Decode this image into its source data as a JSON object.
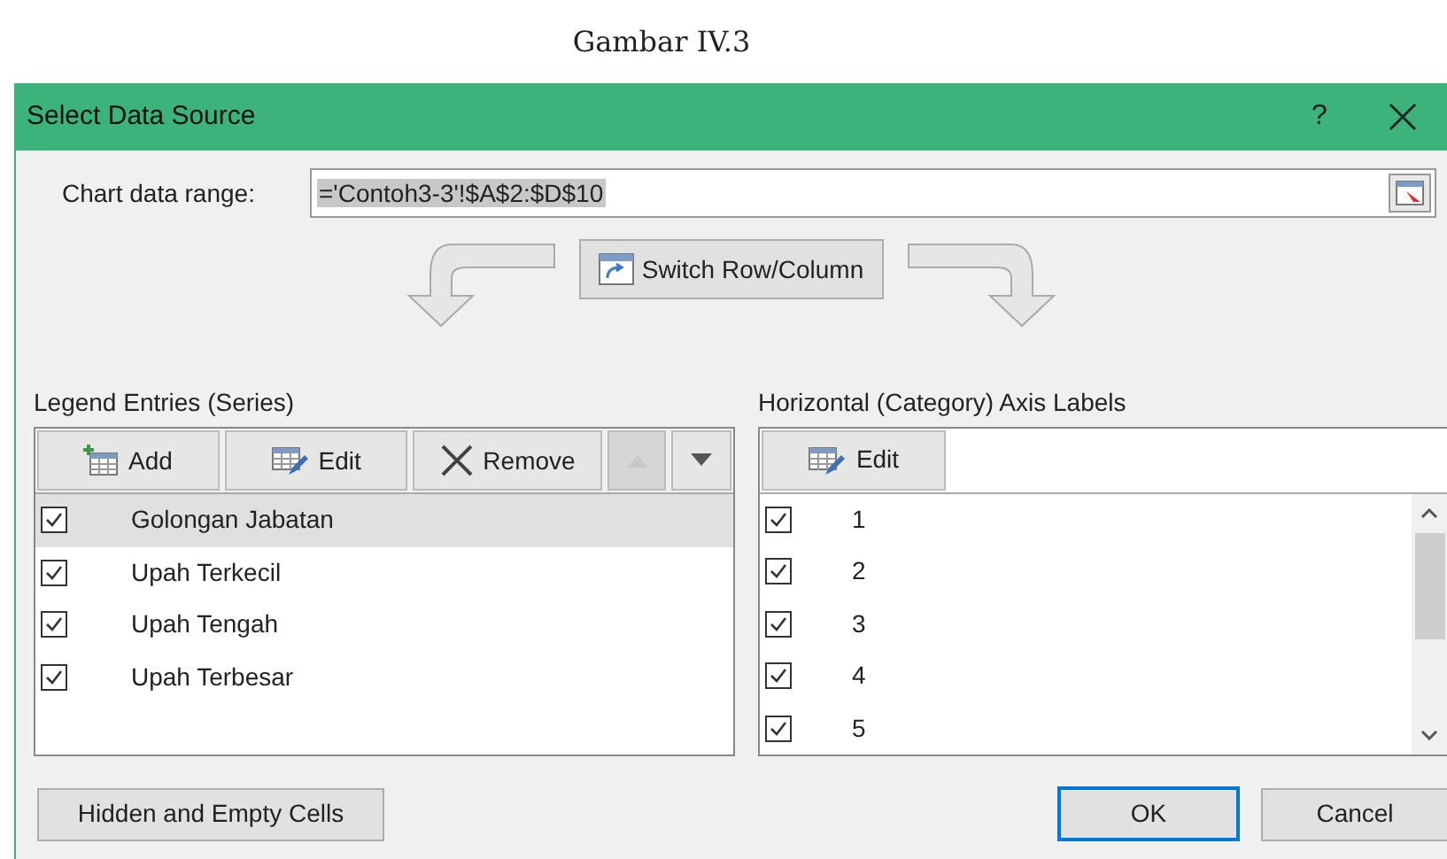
{
  "caption": "Gambar IV.3",
  "window": {
    "title": "Select Data Source",
    "help": "?"
  },
  "range": {
    "label": "Chart data range:",
    "value": "='Contoh3-3'!$A$2:$D$10"
  },
  "switch_button": "Switch Row/Column",
  "legend": {
    "title": "Legend Entries (Series)",
    "buttons": [
      {
        "kind": "add",
        "label": "Add",
        "disabled": false
      },
      {
        "kind": "edit",
        "label": "Edit",
        "disabled": false
      },
      {
        "kind": "remove",
        "label": "Remove",
        "disabled": false
      },
      {
        "kind": "up",
        "disabled": true
      },
      {
        "kind": "down",
        "disabled": false
      }
    ],
    "items": [
      {
        "label": "Golongan Jabatan",
        "checked": true,
        "selected": true
      },
      {
        "label": "Upah Terkecil",
        "checked": true,
        "selected": false
      },
      {
        "label": "Upah Tengah",
        "checked": true,
        "selected": false
      },
      {
        "label": "Upah Terbesar",
        "checked": true,
        "selected": false
      }
    ]
  },
  "axis": {
    "title": "Horizontal (Category) Axis Labels",
    "edit_button": "Edit",
    "items": [
      {
        "label": "1",
        "checked": true
      },
      {
        "label": "2",
        "checked": true
      },
      {
        "label": "3",
        "checked": true
      },
      {
        "label": "4",
        "checked": true
      },
      {
        "label": "5",
        "checked": true
      }
    ]
  },
  "buttons": {
    "hidden": "Hidden and Empty Cells",
    "ok": "OK",
    "cancel": "Cancel"
  }
}
